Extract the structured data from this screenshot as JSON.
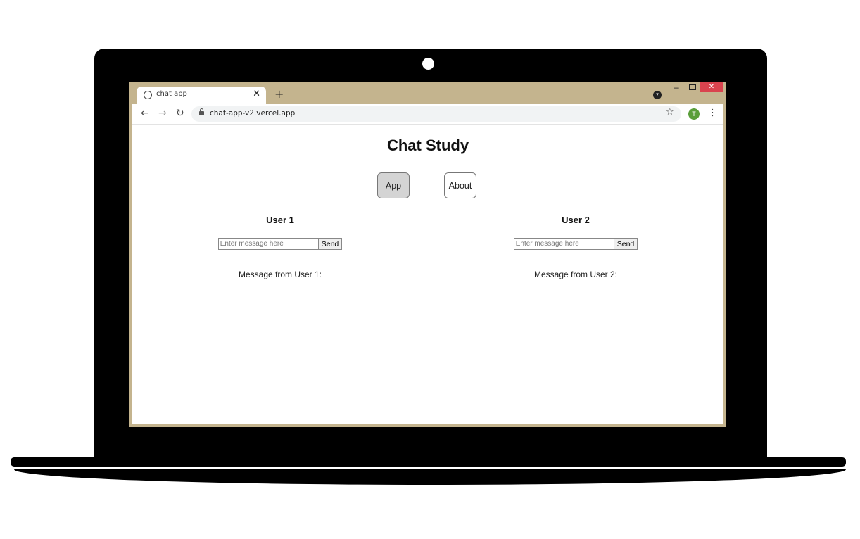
{
  "browser": {
    "tab_title": "chat app",
    "tab_close": "✕",
    "new_tab": "+",
    "url": "chat-app-v2.vercel.app",
    "back": "←",
    "forward": "→",
    "reload": "↻",
    "star": "☆",
    "avatar_letter": "T",
    "menu": "⋮",
    "minimize": "–",
    "close": "✕",
    "profile_dropdown": "▾"
  },
  "page": {
    "title": "Chat Study",
    "nav": [
      {
        "label": "App",
        "active": true
      },
      {
        "label": "About",
        "active": false
      }
    ],
    "users": [
      {
        "heading": "User 1",
        "input_placeholder": "Enter message here",
        "input_value": "",
        "send_label": "Send",
        "message_label": "Message from User 1:"
      },
      {
        "heading": "User 2",
        "input_placeholder": "Enter message here",
        "input_value": "",
        "send_label": "Send",
        "message_label": "Message from User 2:"
      }
    ]
  },
  "colors": {
    "browser_frame": "#c4b48e",
    "window_close": "#d9434e",
    "avatar": "#5a9e3a",
    "active_nav": "#d4d4d4"
  }
}
